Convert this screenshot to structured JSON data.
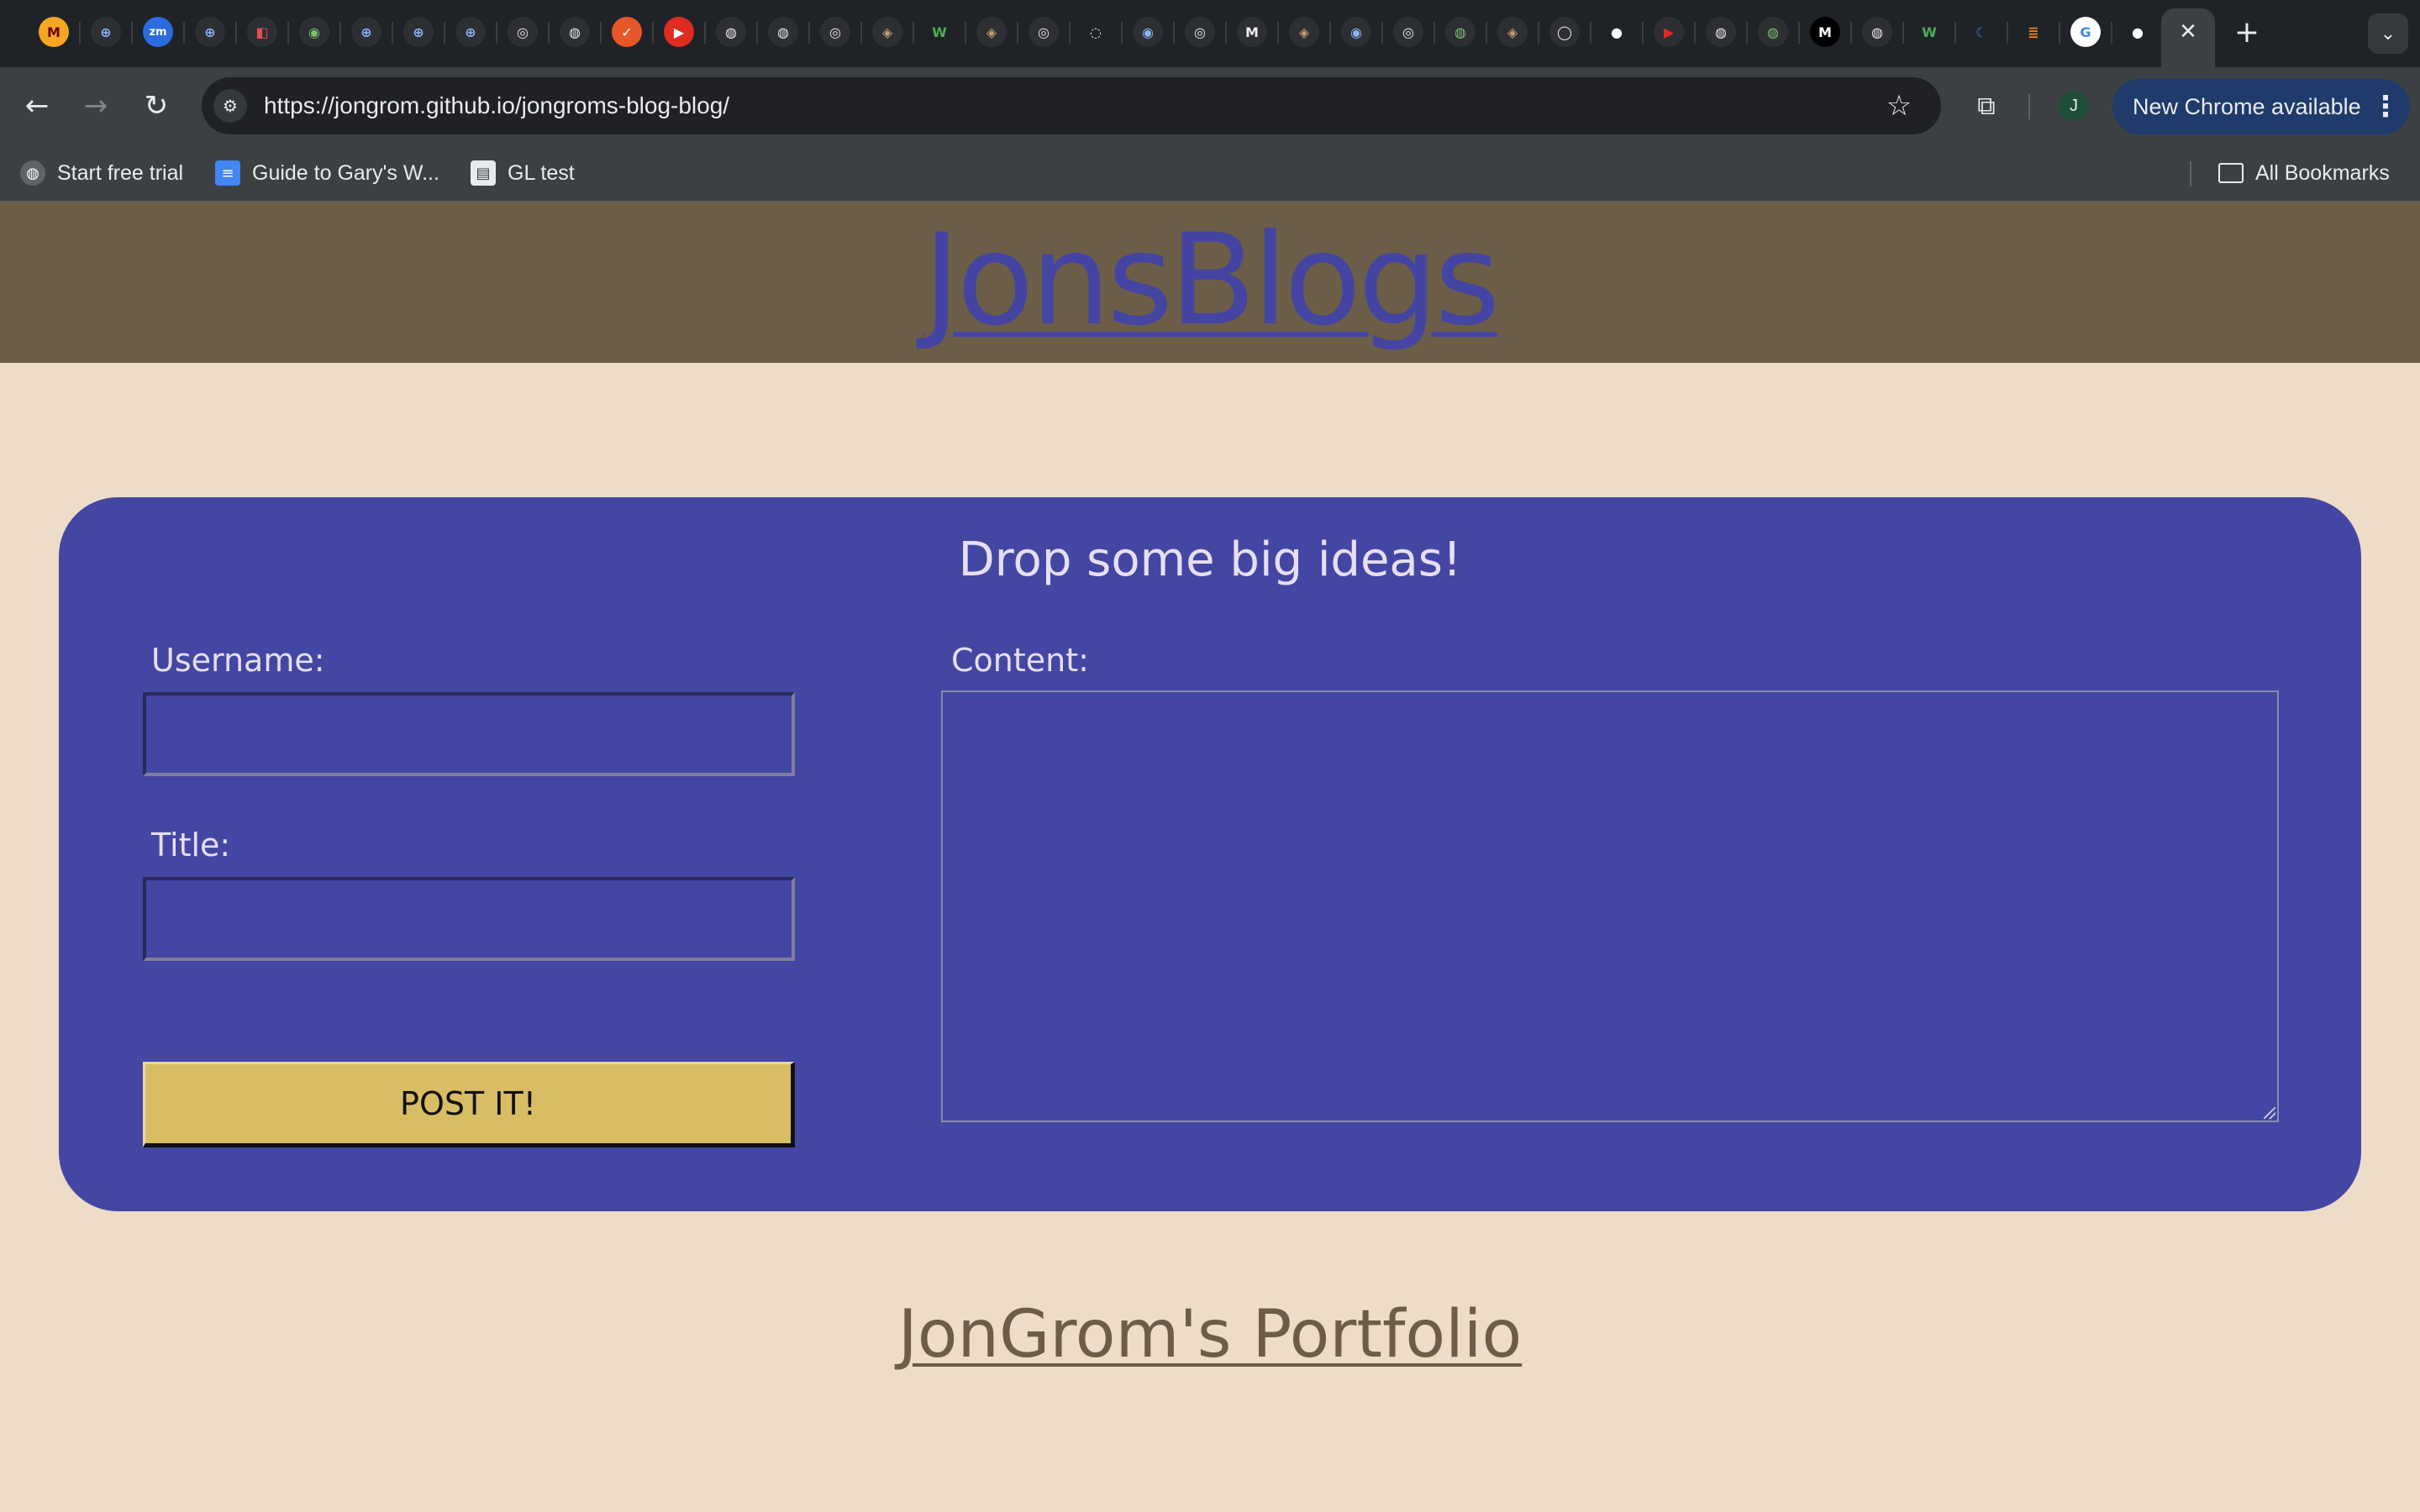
{
  "browser": {
    "tabs": [
      {
        "icon": "gopher-icon",
        "bg": "#f5a623",
        "glyph": "M",
        "fg": "#6b0000"
      },
      {
        "icon": "zoom-icon",
        "bg": "#2d2f33",
        "glyph": "⊕",
        "fg": "#8ab4f8"
      },
      {
        "icon": "zoom-icon",
        "bg": "#2d6cdf",
        "glyph": "zm",
        "fg": "#ffffff"
      },
      {
        "icon": "zoom-icon",
        "bg": "#2d2f33",
        "glyph": "⊕",
        "fg": "#8ab4f8"
      },
      {
        "icon": "app-icon",
        "bg": "#2d2f33",
        "glyph": "◧",
        "fg": "#e05050"
      },
      {
        "icon": "shield-icon",
        "bg": "#2d2f33",
        "glyph": "◉",
        "fg": "#7ac070"
      },
      {
        "icon": "zoom-icon",
        "bg": "#2d2f33",
        "glyph": "⊕",
        "fg": "#8ab4f8"
      },
      {
        "icon": "zoom-icon",
        "bg": "#2d2f33",
        "glyph": "⊕",
        "fg": "#8ab4f8"
      },
      {
        "icon": "zoom-icon",
        "bg": "#2d2f33",
        "glyph": "⊕",
        "fg": "#8ab4f8"
      },
      {
        "icon": "chrome-icon",
        "bg": "#2d2f33",
        "glyph": "◎",
        "fg": "#e8eaed"
      },
      {
        "icon": "globe-icon",
        "bg": "#2d2f33",
        "glyph": "◍",
        "fg": "#e8eaed"
      },
      {
        "icon": "app-icon",
        "bg": "#e8572a",
        "glyph": "✓",
        "fg": "#ffffff"
      },
      {
        "icon": "youtube-icon",
        "bg": "#e02b20",
        "glyph": "▶",
        "fg": "#ffffff"
      },
      {
        "icon": "globe-icon",
        "bg": "#2d2f33",
        "glyph": "◍",
        "fg": "#e8eaed"
      },
      {
        "icon": "globe-icon",
        "bg": "#2d2f33",
        "glyph": "◍",
        "fg": "#e8eaed"
      },
      {
        "icon": "app-icon",
        "bg": "#2d2f33",
        "glyph": "◎",
        "fg": "#e8eaed"
      },
      {
        "icon": "app-icon",
        "bg": "#2d2f33",
        "glyph": "◈",
        "fg": "#c0a070"
      },
      {
        "icon": "w3schools-icon",
        "bg": "#1f2227",
        "glyph": "W",
        "fg": "#4caf50"
      },
      {
        "icon": "app-icon",
        "bg": "#2d2f33",
        "glyph": "◈",
        "fg": "#c0a070"
      },
      {
        "icon": "app-icon",
        "bg": "#2d2f33",
        "glyph": "◎",
        "fg": "#e8eaed"
      },
      {
        "icon": "loading-icon",
        "bg": "#1f2227",
        "glyph": "◌",
        "fg": "#e8eaed"
      },
      {
        "icon": "app-icon",
        "bg": "#2d2f33",
        "glyph": "◉",
        "fg": "#8ab4f8"
      },
      {
        "icon": "app-icon",
        "bg": "#2d2f33",
        "glyph": "◎",
        "fg": "#e8eaed"
      },
      {
        "icon": "app-icon",
        "bg": "#2d2f33",
        "glyph": "M",
        "fg": "#e8eaed"
      },
      {
        "icon": "app-icon",
        "bg": "#2d2f33",
        "glyph": "◈",
        "fg": "#c0a070"
      },
      {
        "icon": "app-icon",
        "bg": "#2d2f33",
        "glyph": "◉",
        "fg": "#8ab4f8"
      },
      {
        "icon": "app-icon",
        "bg": "#2d2f33",
        "glyph": "◎",
        "fg": "#e8eaed"
      },
      {
        "icon": "app-icon",
        "bg": "#2d2f33",
        "glyph": "◍",
        "fg": "#7ac070"
      },
      {
        "icon": "app-icon",
        "bg": "#2d2f33",
        "glyph": "◈",
        "fg": "#c0a070"
      },
      {
        "icon": "github-icon",
        "bg": "#2d2f33",
        "glyph": "◯",
        "fg": "#e8eaed"
      },
      {
        "icon": "github-icon",
        "bg": "#1f2227",
        "glyph": "●",
        "fg": "#ffffff"
      },
      {
        "icon": "youtube-icon",
        "bg": "#2d2f33",
        "glyph": "▶",
        "fg": "#e02b20"
      },
      {
        "icon": "globe-icon",
        "bg": "#2d2f33",
        "glyph": "◍",
        "fg": "#e8eaed"
      },
      {
        "icon": "app-icon",
        "bg": "#2d2f33",
        "glyph": "◍",
        "fg": "#7ac070"
      },
      {
        "icon": "medium-icon",
        "bg": "#000000",
        "glyph": "M",
        "fg": "#ffffff"
      },
      {
        "icon": "globe-icon",
        "bg": "#2d2f33",
        "glyph": "◍",
        "fg": "#e8eaed"
      },
      {
        "icon": "w3schools-icon",
        "bg": "#1f2227",
        "glyph": "W",
        "fg": "#4caf50"
      },
      {
        "icon": "moon-icon",
        "bg": "#1f2227",
        "glyph": "☾",
        "fg": "#4a7fd8"
      },
      {
        "icon": "stackoverflow-icon",
        "bg": "#1f2227",
        "glyph": "≣",
        "fg": "#f48024"
      },
      {
        "icon": "google-icon",
        "bg": "#ffffff",
        "glyph": "G",
        "fg": "#4285f4"
      },
      {
        "icon": "github-icon",
        "bg": "#1f2227",
        "glyph": "●",
        "fg": "#ffffff"
      }
    ],
    "new_tab_glyph": "+",
    "close_glyph": "✕",
    "url": "https://jongrom.github.io/jongroms-blog-blog/",
    "profile_initial": "J",
    "update_label": "New Chrome available",
    "bookmarks": [
      {
        "label": "Start free trial",
        "icon": "globe-icon",
        "glyph": "◍",
        "bg": "#5f6368",
        "fg": "#ffffff"
      },
      {
        "label": "Guide to Gary's W...",
        "icon": "google-docs-icon",
        "glyph": "≡",
        "bg": "#4285f4",
        "fg": "#ffffff"
      },
      {
        "label": "GL test",
        "icon": "file-icon",
        "glyph": "▤",
        "bg": "#e8eaed",
        "fg": "#3c4043"
      }
    ],
    "all_bookmarks_label": "All Bookmarks"
  },
  "site": {
    "title": "JonsBlogs",
    "form": {
      "heading": "Drop some big ideas!",
      "username_label": "Username:",
      "username_value": "",
      "title_label": "Title:",
      "title_value": "",
      "content_label": "Content:",
      "content_value": "",
      "submit_label": "POST IT!"
    },
    "footer_link": "JonGrom's Portfolio"
  },
  "colors": {
    "header_bg": "#6b5d48",
    "page_bg": "#ecdcc8",
    "card_bg": "#4446a3",
    "button_bg": "#d9bd65",
    "title_color": "#4444a3"
  }
}
